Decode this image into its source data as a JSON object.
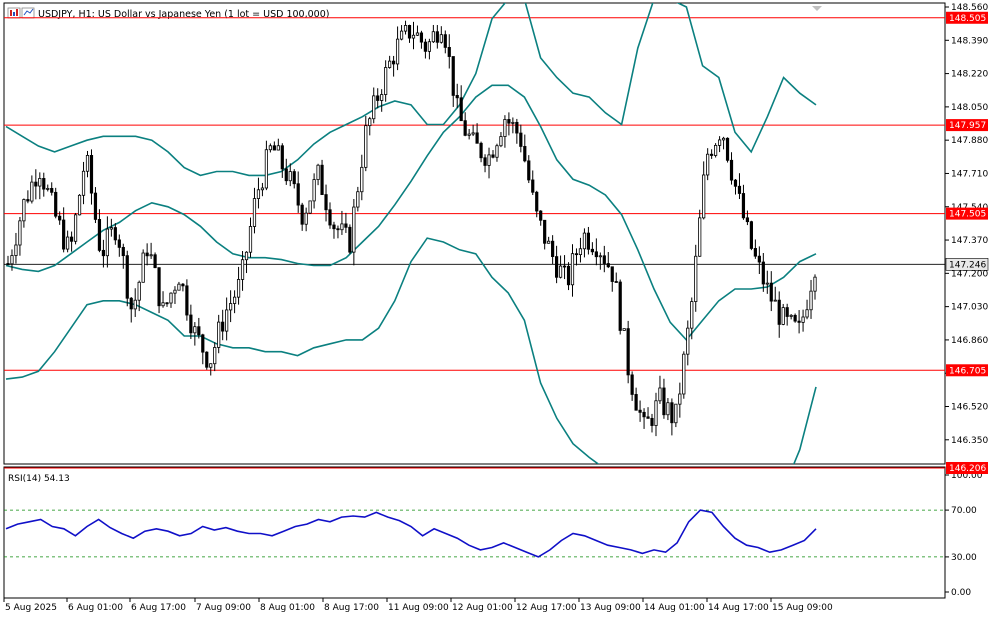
{
  "header": {
    "title": "USDJPY, H1:  US Dollar vs Japanese Yen (1 lot = USD 100,000)",
    "rsi_label": "RSI(14) 54.13"
  },
  "colors": {
    "candle": "#000000",
    "bollinger": "#0b8080",
    "level": "#ff0000",
    "rsi_line": "#1010c8",
    "rsi_level": "#0a8a0a",
    "frame": "#000000",
    "current_price": "#000000"
  },
  "chart_data": [
    {
      "type": "candlestick",
      "symbol": "USDJPY",
      "timeframe": "H1",
      "ylim": [
        146.206,
        148.56
      ],
      "y_ticks": [
        "148.560",
        "148.390",
        "148.220",
        "148.050",
        "147.880",
        "147.710",
        "147.540",
        "147.370",
        "147.200",
        "147.030",
        "146.860",
        "146.690",
        "146.520",
        "146.350"
      ],
      "x_ticks": [
        "5 Aug 2025",
        "6 Aug 01:00",
        "6 Aug 17:00",
        "7 Aug 09:00",
        "8 Aug 01:00",
        "8 Aug 17:00",
        "11 Aug 09:00",
        "12 Aug 01:00",
        "12 Aug 17:00",
        "13 Aug 09:00",
        "14 Aug 01:00",
        "14 Aug 17:00",
        "15 Aug 09:00"
      ],
      "horizontal_levels": [
        {
          "value": 148.505,
          "label": "148.505"
        },
        {
          "value": 147.957,
          "label": "147.957"
        },
        {
          "value": 147.505,
          "label": "147.505"
        },
        {
          "value": 146.705,
          "label": "146.705"
        },
        {
          "value": 146.206,
          "label": "146.206"
        }
      ],
      "current_price": {
        "value": 147.246,
        "label": "147.246"
      },
      "indicator": "Bollinger Bands",
      "bollinger_middle": [
        147.24,
        147.22,
        147.21,
        147.24,
        147.3,
        147.36,
        147.42,
        147.46,
        147.52,
        147.56,
        147.54,
        147.5,
        147.44,
        147.36,
        147.3,
        147.28,
        147.28,
        147.27,
        147.25,
        147.24,
        147.24,
        147.28,
        147.36,
        147.44,
        147.55,
        147.67,
        147.8,
        147.92,
        148.0,
        148.1,
        148.16,
        148.16,
        148.1,
        147.95,
        147.78,
        147.68,
        147.65,
        147.6,
        147.5,
        147.32,
        147.12,
        146.95,
        146.86,
        146.96,
        147.06,
        147.12,
        147.12,
        147.13,
        147.18,
        147.26,
        147.3
      ],
      "bollinger_upper": [
        147.95,
        147.9,
        147.85,
        147.82,
        147.85,
        147.88,
        147.9,
        147.9,
        147.9,
        147.88,
        147.82,
        147.74,
        147.7,
        147.72,
        147.72,
        147.7,
        147.7,
        147.72,
        147.78,
        147.86,
        147.92,
        147.96,
        148.0,
        148.05,
        148.08,
        148.06,
        147.96,
        147.96,
        148.06,
        148.22,
        148.5,
        148.6,
        148.6,
        148.3,
        148.2,
        148.12,
        148.1,
        148.02,
        147.96,
        148.35,
        148.6,
        148.6,
        148.56,
        148.26,
        148.2,
        147.92,
        147.82,
        148.0,
        148.2,
        148.12,
        148.06
      ],
      "bollinger_lower": [
        146.66,
        146.67,
        146.7,
        146.8,
        146.92,
        147.04,
        147.06,
        147.06,
        147.04,
        147.0,
        146.96,
        146.88,
        146.88,
        146.84,
        146.82,
        146.82,
        146.8,
        146.8,
        146.78,
        146.82,
        146.84,
        146.86,
        146.86,
        146.92,
        147.06,
        147.26,
        147.38,
        147.36,
        147.32,
        147.3,
        147.18,
        147.1,
        146.96,
        146.64,
        146.46,
        146.33,
        146.26,
        146.2,
        146.06,
        145.96,
        145.9,
        145.96,
        146.0,
        146.0,
        145.98,
        145.96,
        145.96,
        145.96,
        146.1,
        146.3,
        146.62
      ],
      "rsi": {
        "period": 14,
        "ylim": [
          0,
          100
        ],
        "ticks": [
          "100.00",
          "70.00",
          "30.00",
          "0.00"
        ],
        "levels": [
          70,
          30
        ],
        "current": 54.13,
        "values": [
          54,
          58,
          60,
          62,
          56,
          54,
          48,
          56,
          62,
          55,
          50,
          46,
          52,
          54,
          52,
          48,
          50,
          56,
          53,
          55,
          52,
          50,
          50,
          48,
          52,
          56,
          58,
          62,
          60,
          64,
          65,
          64,
          68,
          64,
          61,
          56,
          48,
          54,
          50,
          46,
          40,
          36,
          38,
          42,
          38,
          34,
          30,
          36,
          44,
          50,
          48,
          44,
          40,
          38,
          36,
          33,
          36,
          34,
          42,
          60,
          70,
          68,
          56,
          46,
          40,
          38,
          34,
          36,
          40,
          44,
          54
        ]
      }
    }
  ]
}
